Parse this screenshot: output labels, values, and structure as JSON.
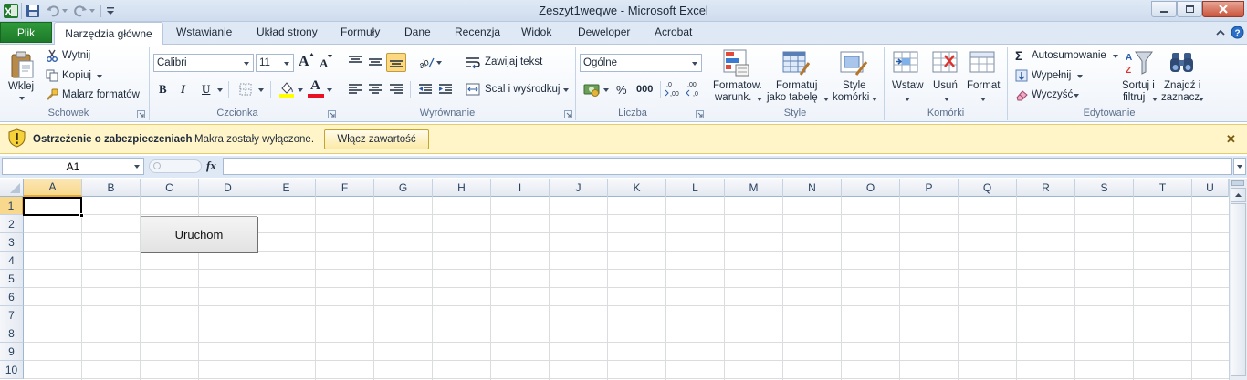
{
  "window": {
    "title": "Zeszyt1weqwe  -  Microsoft Excel",
    "app_icon": "excel-icon",
    "controls": [
      "minimize-icon",
      "restore-icon",
      "close-icon"
    ]
  },
  "quick_access": [
    "save-icon",
    "undo-icon",
    "redo-icon",
    "customize-icon"
  ],
  "tabs": [
    {
      "label": "Plik"
    },
    {
      "label": "Narzędzia główne",
      "active": true
    },
    {
      "label": "Wstawianie"
    },
    {
      "label": "Układ strony"
    },
    {
      "label": "Formuły"
    },
    {
      "label": "Dane"
    },
    {
      "label": "Recenzja"
    },
    {
      "label": "Widok"
    },
    {
      "label": "Deweloper"
    },
    {
      "label": "Acrobat"
    }
  ],
  "ribbon": {
    "clipboard": {
      "paste": "Wklej",
      "cut": "Wytnij",
      "copy": "Kopiuj",
      "format_painter": "Malarz formatów",
      "group": "Schowek"
    },
    "font": {
      "name": "Calibri",
      "size": "11",
      "grow": "A",
      "shrink": "A",
      "bold": "B",
      "italic": "I",
      "underline": "U",
      "font_color_letter": "A",
      "group": "Czcionka",
      "fill_color": "#ffff00",
      "text_color": "#e81123"
    },
    "alignment": {
      "wrap": "Zawijaj tekst",
      "merge": "Scal i wyśrodkuj",
      "group": "Wyrównanie"
    },
    "number": {
      "format": "Ogólne",
      "percent": "%",
      "thousands": "000",
      "inc_dec": ",0\n,00",
      "dec_dec": ",00\n,0",
      "group": "Liczba"
    },
    "styles": {
      "conditional": [
        "Formatow.",
        "warunk."
      ],
      "as_table": [
        "Formatuj",
        "jako tabelę"
      ],
      "cell_styles": [
        "Style",
        "komórki"
      ],
      "group": "Style"
    },
    "cells": {
      "insert": "Wstaw",
      "delete": "Usuń",
      "format": "Format",
      "group": "Komórki"
    },
    "editing": {
      "autosum": "Autosumowanie",
      "fill": "Wypełnij",
      "clear": "Wyczyść",
      "sort": [
        "Sortuj i",
        "filtruj"
      ],
      "find": [
        "Znajdź i",
        "zaznacz"
      ],
      "group": "Edytowanie"
    }
  },
  "security_bar": {
    "title": "Ostrzeżenie o zabezpieczeniach",
    "message": "Makra zostały wyłączone.",
    "button": "Włącz zawartość",
    "close": "✕"
  },
  "formula_bar": {
    "name_box": "A1",
    "fx": "fx",
    "value": ""
  },
  "sheet": {
    "columns": [
      "A",
      "B",
      "C",
      "D",
      "E",
      "F",
      "G",
      "H",
      "I",
      "J",
      "K",
      "L",
      "M",
      "N",
      "O",
      "P",
      "Q",
      "R",
      "S",
      "T",
      "U"
    ],
    "rows": [
      "1",
      "2",
      "3",
      "4",
      "5",
      "6",
      "7",
      "8",
      "9",
      "10"
    ],
    "active_cell": "A1",
    "form_button": "Uruchom"
  },
  "colors": {
    "file_tab": "#1d7a2a",
    "warning_bar": "#fff5c9",
    "selected_header": "#f8d88c"
  }
}
